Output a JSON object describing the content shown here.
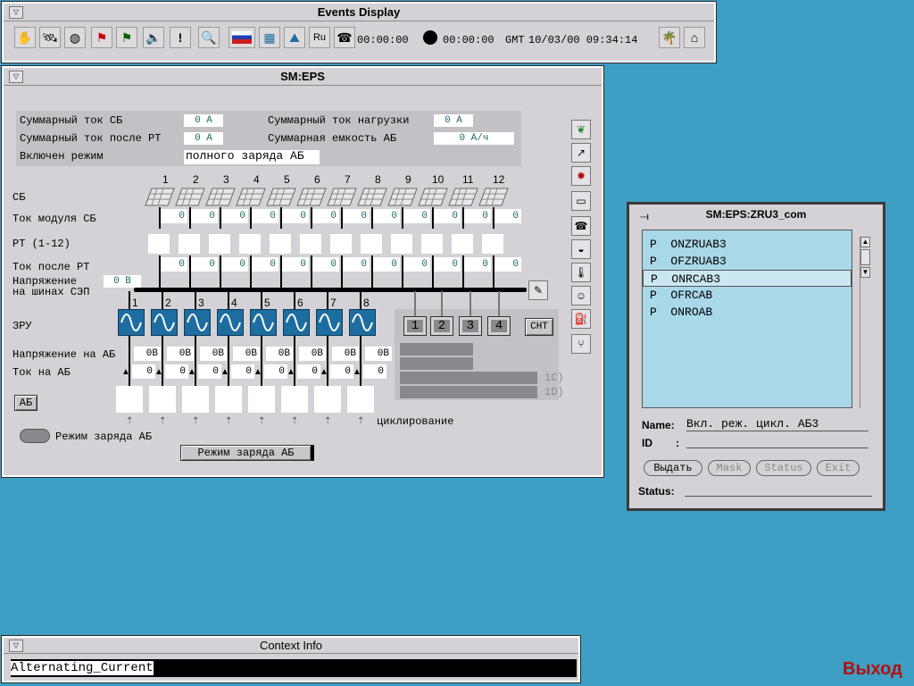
{
  "events": {
    "title": "Events Display",
    "menu_glyph": "▽",
    "toolbar_icons": [
      "hand-icon",
      "satellite-icon",
      "globe-icon",
      "traffic-light-red-icon",
      "traffic-light-icon",
      "speaker-icon",
      "exclamation-icon",
      "magnifier-icon",
      "russia-flag-icon",
      "map-icon",
      "landscape-icon",
      "ru-language-icon",
      "phone-icon"
    ],
    "exclamation_glyph": "!",
    "ru_label": "Ru",
    "timer1": "00:00:00",
    "timer2": "00:00:00",
    "tz": "GMT",
    "datetime": "10/03/00 09:34:14",
    "colors": {
      "accent": "#1e6da0"
    }
  },
  "eps": {
    "title": "SM:EPS",
    "menu_glyph": "▽",
    "info": {
      "sum_sb_label": "Суммарный ток СБ",
      "sum_sb_value": "0 А",
      "sum_load_label": "Суммарный ток нагрузки",
      "sum_load_value": "0 А",
      "sum_after_rt_label": "Суммарный ток после РТ",
      "sum_after_rt_value": "0 А",
      "sum_capacity_label": "Суммарная емкость АБ",
      "sum_capacity_value": "0 А/ч",
      "mode_label": "Включен режим",
      "mode_value": "полного заряда АБ"
    },
    "columns": [
      "1",
      "2",
      "3",
      "4",
      "5",
      "6",
      "7",
      "8",
      "9",
      "10",
      "11",
      "12"
    ],
    "row_labels": {
      "sb": "СБ",
      "module_current": "Ток модуля СБ",
      "rt": "РТ (1-12)",
      "after_rt": "Ток после РТ",
      "bus_voltage_1": "Напряжение",
      "bus_voltage_2": "на шинах СЭП",
      "zru": "ЗРУ",
      "ab_voltage": "Напряжение на АБ",
      "ab_current": "Ток на АБ",
      "ab": "АБ"
    },
    "module_currents": [
      "0",
      "0",
      "0",
      "0",
      "0",
      "0",
      "0",
      "0",
      "0",
      "0",
      "0",
      "0"
    ],
    "after_rt_currents": [
      "0",
      "0",
      "0",
      "0",
      "0",
      "0",
      "0",
      "0",
      "0",
      "0",
      "0",
      "0"
    ],
    "bus_voltage_value": "0 В",
    "zru_numbers": [
      "1",
      "2",
      "3",
      "4",
      "5",
      "6",
      "7",
      "8"
    ],
    "ab_voltages": [
      "0В",
      "0В",
      "0В",
      "0В",
      "0В",
      "0В",
      "0В",
      "0В"
    ],
    "ab_currents": [
      "0",
      "0",
      "0",
      "0",
      "0",
      "0",
      "0",
      "0"
    ],
    "battery_marker": "▲",
    "load_buttons": [
      "1",
      "2",
      "3",
      "4"
    ],
    "cnt_label": "СНТ",
    "bar_labels": [
      "1C)",
      "1D)"
    ],
    "cycling_label": "циклирование",
    "charge_mode_label": "Режим заряда АБ",
    "charge_mode_button": "Режим заряда АБ",
    "side_icons": [
      "leaf-icon",
      "chart-icon",
      "gear-icon",
      "computer-icon",
      "phone-icon",
      "bowl-icon",
      "thermometer-icon",
      "head-icon",
      "fuel-icon",
      "branch-icon"
    ]
  },
  "zru3": {
    "title": "SM:EPS:ZRU3_com",
    "items": [
      {
        "prefix": "P",
        "name": "ONZRUAB3",
        "selected": false
      },
      {
        "prefix": "P",
        "name": "OFZRUAB3",
        "selected": false
      },
      {
        "prefix": "P",
        "name": "ONRCAB3",
        "selected": true
      },
      {
        "prefix": "P",
        "name": "OFRCAB",
        "selected": false
      },
      {
        "prefix": "P",
        "name": "ONROAB",
        "selected": false
      }
    ],
    "name_label": "Name:",
    "name_value": "Вкл. реж. цикл. АБ3",
    "id_label": "ID",
    "id_sep": ":",
    "buttons": {
      "execute": "Выдать",
      "mask": "Mask",
      "status": "Status",
      "exit": "Exit"
    },
    "status_label": "Status:"
  },
  "context": {
    "title": "Context Info",
    "menu_glyph": "▽",
    "value": "Alternating_Current"
  },
  "exit_label": "Выход"
}
